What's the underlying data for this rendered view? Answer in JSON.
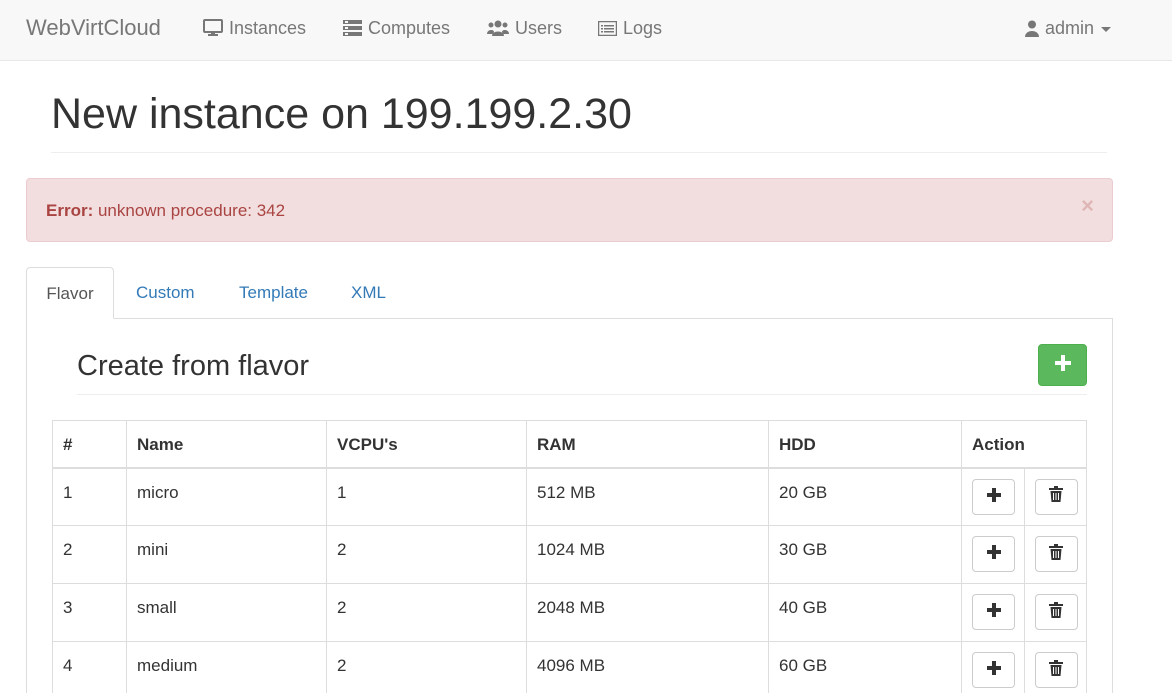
{
  "navbar": {
    "brand": "WebVirtCloud",
    "items": [
      {
        "label": "Instances",
        "icon": "monitor-icon"
      },
      {
        "label": "Computes",
        "icon": "server-icon"
      },
      {
        "label": "Users",
        "icon": "users-icon"
      },
      {
        "label": "Logs",
        "icon": "list-icon"
      }
    ],
    "user": {
      "label": "admin",
      "icon": "user-icon"
    }
  },
  "page": {
    "title": "New instance on 199.199.2.30"
  },
  "alert": {
    "prefix": "Error:",
    "message": " unknown procedure: 342",
    "close": "×",
    "color": "#a94442",
    "background": "#f2dede"
  },
  "tabs": [
    {
      "label": "Flavor",
      "active": true
    },
    {
      "label": "Custom"
    },
    {
      "label": "Template"
    },
    {
      "label": "XML"
    }
  ],
  "flavor_section": {
    "title": "Create from flavor",
    "add_button_icon": "plus-icon",
    "add_button_color": "#5cb85c"
  },
  "table": {
    "headers": [
      "#",
      "Name",
      "VCPU's",
      "RAM",
      "HDD",
      "Action"
    ],
    "rows": [
      {
        "num": "1",
        "name": "micro",
        "vcpu": "1",
        "ram": "512 MB",
        "hdd": "20 GB"
      },
      {
        "num": "2",
        "name": "mini",
        "vcpu": "2",
        "ram": "1024 MB",
        "hdd": "30 GB"
      },
      {
        "num": "3",
        "name": "small",
        "vcpu": "2",
        "ram": "2048 MB",
        "hdd": "40 GB"
      },
      {
        "num": "4",
        "name": "medium",
        "vcpu": "2",
        "ram": "4096 MB",
        "hdd": "60 GB"
      }
    ],
    "row_actions": [
      "plus-icon",
      "trash-icon"
    ]
  },
  "colors": {
    "link": "#337ab7",
    "navbar_text": "#777777"
  }
}
